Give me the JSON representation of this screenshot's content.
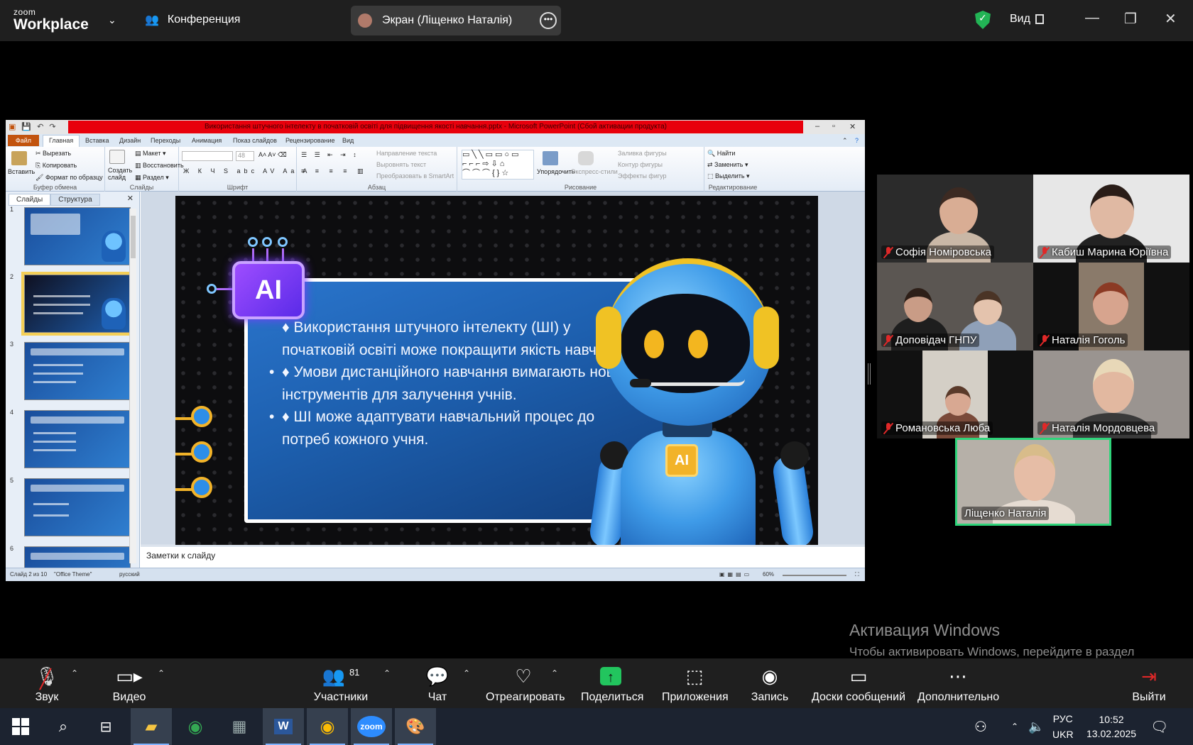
{
  "zoom_header": {
    "logo_small": "zoom",
    "logo_big": "Workplace",
    "meeting_label": "Конференция",
    "screen_share_label": "Экран (Ліщенко Наталія)",
    "view_label": "Вид"
  },
  "ppt": {
    "title": "Використання штучного інтелекту в початковій освіті для підвищення якості навчання.pptx - Microsoft PowerPoint (Сбой активации продукта)",
    "tabs": [
      "Файл",
      "Главная",
      "Вставка",
      "Дизайн",
      "Переходы",
      "Анимация",
      "Показ слайдов",
      "Рецензирование",
      "Вид"
    ],
    "ribbon": {
      "clipboard": {
        "paste": "Вставить",
        "cut": "Вырезать",
        "copy": "Копировать",
        "format": "Формат по образцу",
        "label": "Буфер обмена"
      },
      "slides": {
        "create": "Создать слайд",
        "layout": "Макет",
        "reset": "Восстановить",
        "section": "Раздел",
        "label": "Слайды"
      },
      "font": {
        "size": "48",
        "label": "Шрифт"
      },
      "paragraph": {
        "dir": "Направление текста",
        "align": "Выровнять текст",
        "smartart": "Преобразовать в SmartArt",
        "label": "Абзац"
      },
      "drawing": {
        "arrange": "Упорядочить",
        "styles": "Экспресс-стили",
        "fill": "Заливка фигуры",
        "outline": "Контур фигуры",
        "effects": "Эффекты фигур",
        "label": "Рисование"
      },
      "editing": {
        "find": "Найти",
        "replace": "Заменить",
        "select": "Выделить",
        "label": "Редактирование"
      }
    },
    "panel_tabs": [
      "Слайды",
      "Структура"
    ],
    "thumbnails": [
      "1",
      "2",
      "3",
      "4",
      "5",
      "6"
    ],
    "slide": {
      "chip_text": "AI",
      "badge_text": "AI",
      "bullets": [
        "♦ Використання штучного інтелекту (ШІ) у початковій освіті може покращити якість навчання.",
        "♦ Умови дистанційного навчання вимагають нових інструментів для залучення учнів.",
        "♦ ШІ може адаптувати навчальний процес до потреб кожного учня."
      ]
    },
    "notes_placeholder": "Заметки к слайду",
    "status": {
      "slide": "Слайд 2 из 10",
      "theme": "\"Office Theme\"",
      "lang": "русский",
      "zoom": "60%"
    }
  },
  "participants": [
    {
      "name": "Софія Номіровська",
      "muted": true
    },
    {
      "name": "Кабиш Марина Юріївна",
      "muted": true
    },
    {
      "name": "Доповідач ГНПУ",
      "muted": true
    },
    {
      "name": "Наталія Гоголь",
      "muted": true
    },
    {
      "name": "Романовська Люба",
      "muted": true
    },
    {
      "name": "Наталія Мордовцева",
      "muted": true
    },
    {
      "name": "Ліщенко Наталія",
      "muted": false
    }
  ],
  "activation": {
    "title": "Активация Windows",
    "text": "Чтобы активировать Windows, перейдите в раздел \"Параметры\"."
  },
  "toolbar": {
    "audio": "Звук",
    "video": "Видео",
    "participants": "Участники",
    "participants_count": "81",
    "chat": "Чат",
    "react": "Отреагировать",
    "share": "Поделиться",
    "apps": "Приложения",
    "record": "Запись",
    "whiteboards": "Доски сообщений",
    "more": "Дополнительно",
    "leave": "Выйти"
  },
  "taskbar": {
    "lang_top": "РУС",
    "lang_bottom": "UKR",
    "time": "10:52",
    "date": "13.02.2025"
  },
  "colors": {
    "accent_green": "#22c55e",
    "ppt_red": "#e8000c",
    "leave_red": "#e02828"
  }
}
